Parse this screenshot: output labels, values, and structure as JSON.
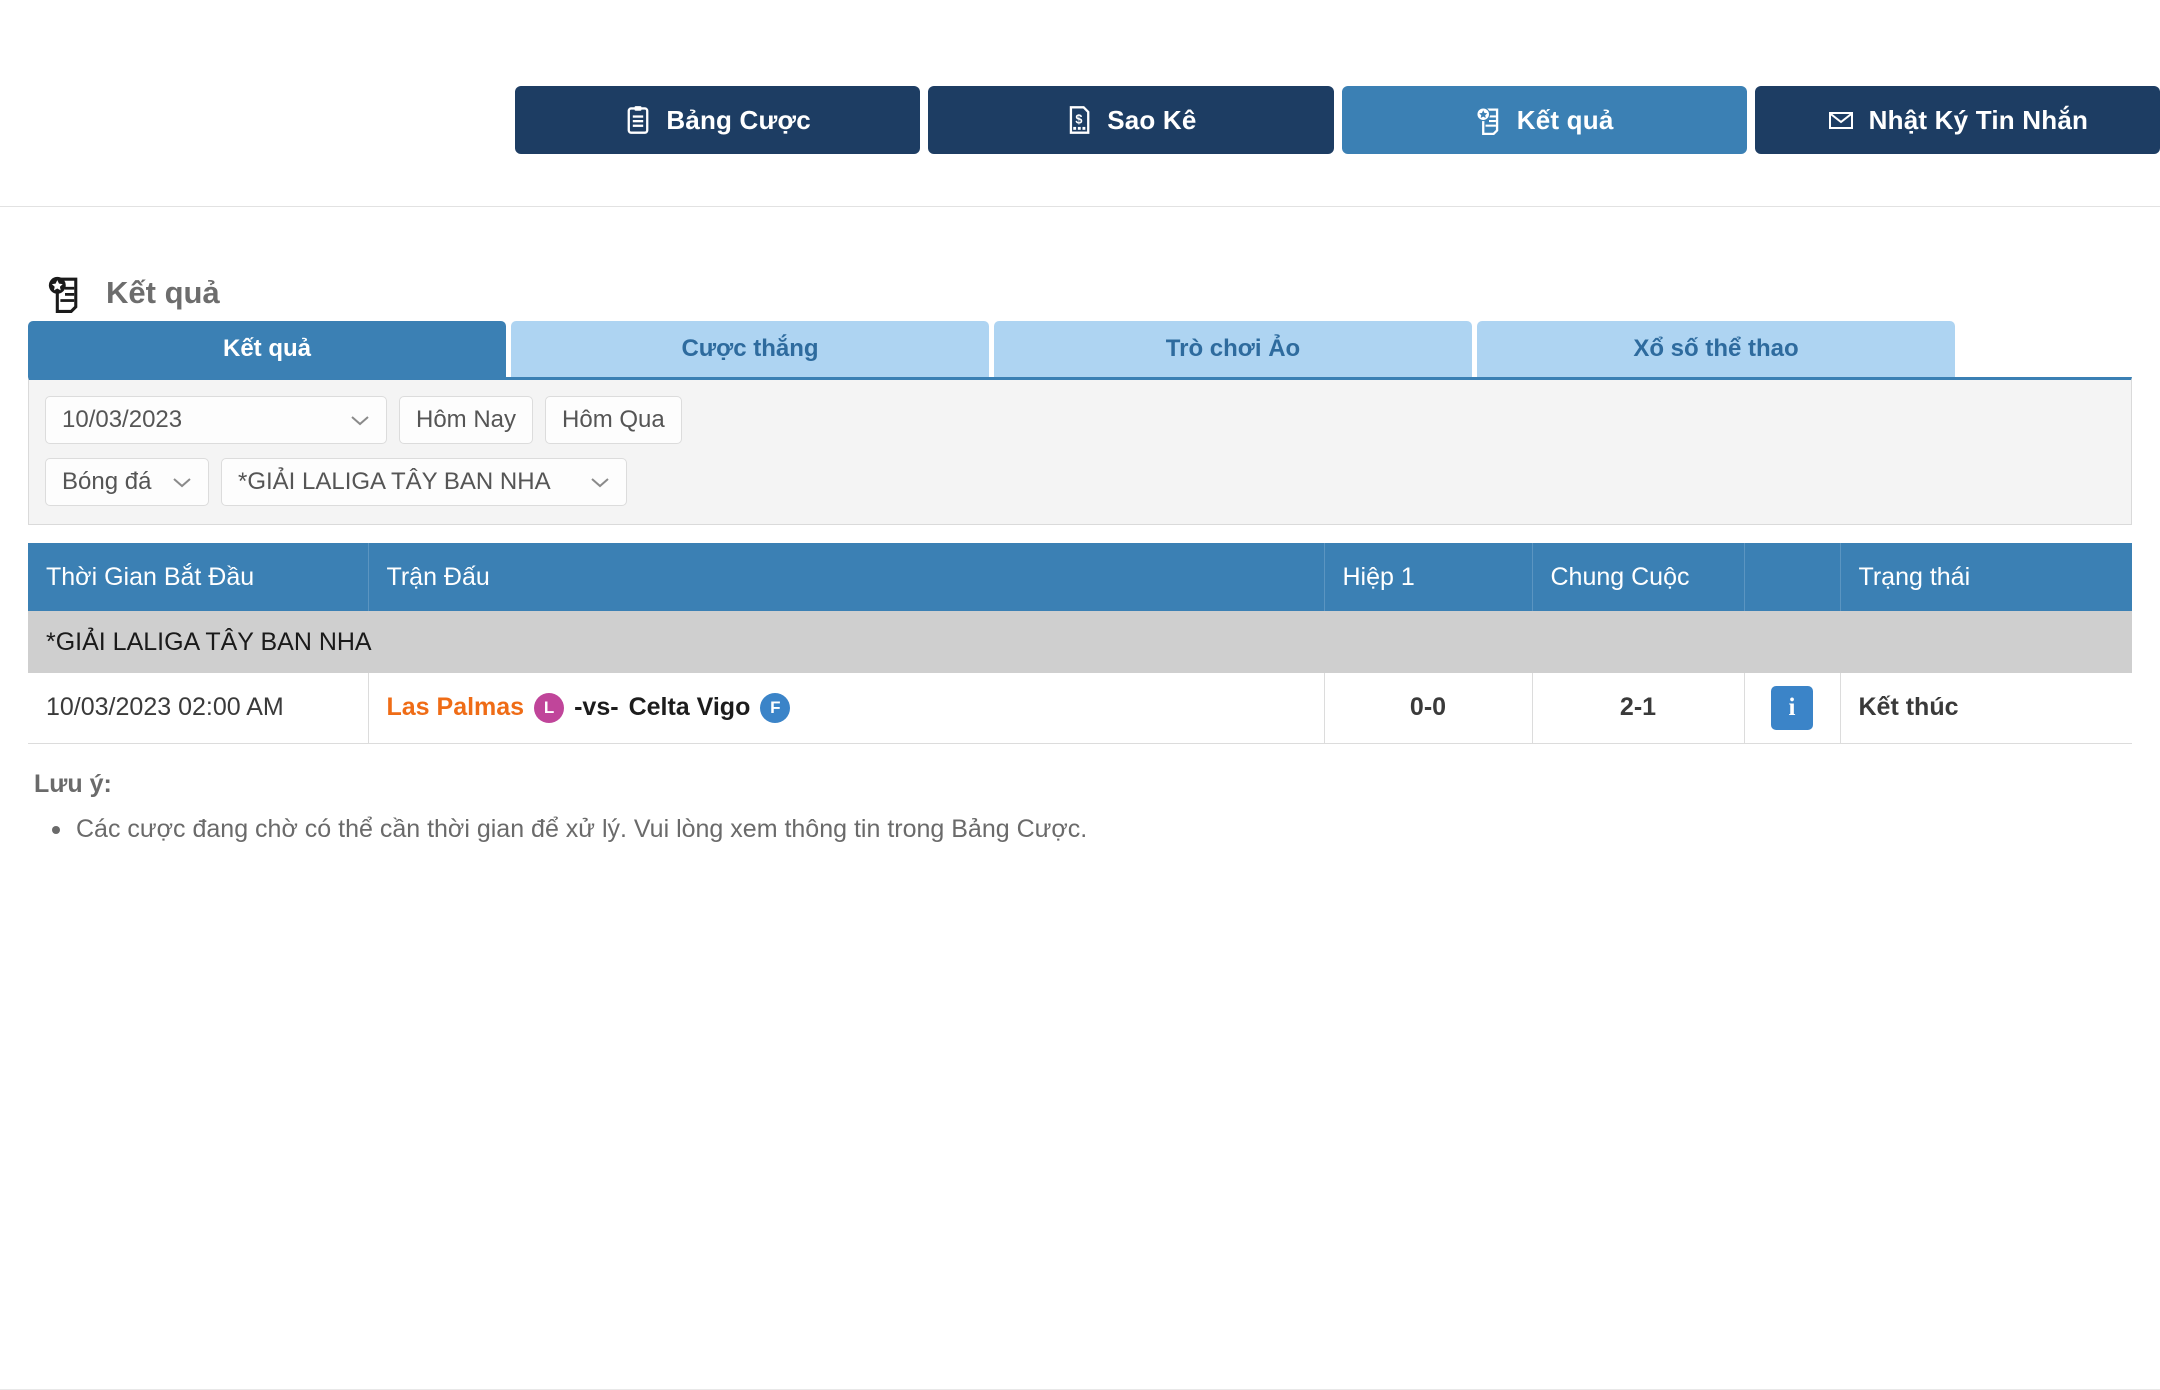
{
  "topnav": {
    "buttons": [
      {
        "label": "Bảng Cược",
        "icon": "clipboard-icon",
        "state": "dark"
      },
      {
        "label": "Sao Kê",
        "icon": "statement-icon",
        "state": "dark"
      },
      {
        "label": "Kết quả",
        "icon": "results-icon",
        "state": "active"
      },
      {
        "label": "Nhật Ký Tin Nhắn",
        "icon": "envelope-icon",
        "state": "dark"
      }
    ]
  },
  "page": {
    "title": "Kết quả",
    "title_icon": "results-icon"
  },
  "tabs": [
    {
      "label": "Kết quả",
      "active": true
    },
    {
      "label": "Cược thắng",
      "active": false
    },
    {
      "label": "Trò chơi Ảo",
      "active": false
    },
    {
      "label": "Xổ số thể thao",
      "active": false
    }
  ],
  "filters": {
    "date_value": "10/03/2023",
    "today_label": "Hôm Nay",
    "yesterday_label": "Hôm Qua",
    "sport_value": "Bóng đá",
    "league_value": "*GIẢI LALIGA TÂY BAN NHA"
  },
  "table": {
    "headers": {
      "start_time": "Thời Gian Bắt Đầu",
      "match": "Trận Đấu",
      "half": "Hiệp 1",
      "full": "Chung Cuộc",
      "info": "",
      "status": "Trạng thái"
    },
    "league_group": "*GIẢI LALIGA TÂY BAN NHA",
    "rows": [
      {
        "start_time": "10/03/2023 02:00 AM",
        "home_team": "Las Palmas",
        "home_badge": "L",
        "home_badge_color": "#c0459a",
        "vs": "-vs-",
        "away_team": "Celta Vigo",
        "away_badge": "F",
        "away_badge_color": "#3b84c8",
        "half_score": "0-0",
        "full_score": "2-1",
        "info_icon": "info-icon",
        "status": "Kết thúc"
      }
    ]
  },
  "notes": {
    "title": "Lưu ý:",
    "items": [
      "Các cược đang chờ có thể cần thời gian để xử lý. Vui lòng xem thông tin trong Bảng Cược."
    ]
  },
  "colors": {
    "nav_dark": "#1d3d63",
    "nav_active": "#3b80b4",
    "tab_idle_bg": "#aed4f2",
    "tab_idle_text": "#2e6b9e",
    "table_header": "#3b80b4",
    "league_row": "#cfcfcf",
    "home_team_text": "#ef6c16"
  }
}
